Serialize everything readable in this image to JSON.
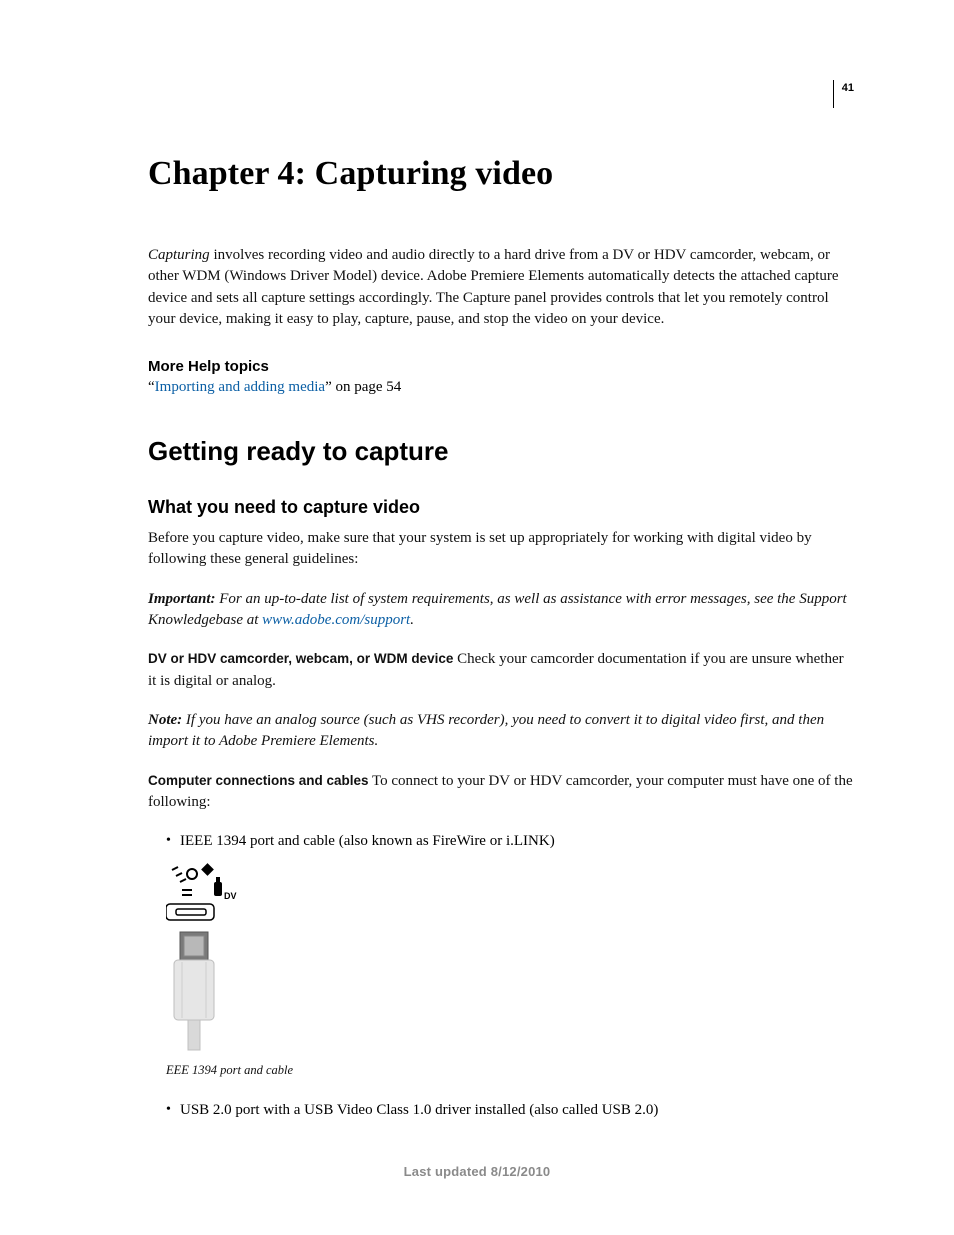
{
  "pageNumber": "41",
  "chapterTitle": "Chapter 4: Capturing video",
  "intro": {
    "leadWord": "Capturing",
    "rest": " involves recording video and audio directly to a hard drive from a DV or HDV camcorder, webcam, or other WDM (Windows Driver Model) device. Adobe Premiere Elements automatically detects the attached capture device and sets all capture settings accordingly. The Capture panel provides controls that let you remotely control your device, making it easy to play, capture, pause, and stop the video on your device."
  },
  "moreHelp": {
    "heading": "More Help topics",
    "quoteOpen": "“",
    "linkText": "Importing and adding media",
    "afterLink": "” on page 54"
  },
  "section1": {
    "title": "Getting ready to capture",
    "subTitle": "What you need to capture video",
    "p1": "Before you capture video, make sure that your system is set up appropriately for working with digital video by following these general guidelines:",
    "important": {
      "label": "Important:",
      "before": " For an up-to-date list of system requirements, as well as assistance with error messages, see the Support Knowledgebase at ",
      "link": "www.adobe.com/support",
      "after": "."
    },
    "dvLine": {
      "label": "DV or HDV camcorder, webcam, or WDM device",
      "text": "   Check your camcorder documentation if you are unsure whether it is digital or analog."
    },
    "note": {
      "label": "Note:",
      "text": " If you have an analog source (such as VHS recorder), you need to convert it to digital video first, and then import it to Adobe Premiere Elements."
    },
    "connLine": {
      "label": "Computer connections and cables",
      "text": "  To connect to your DV or HDV camcorder, your computer must have one of the following:"
    },
    "bullets": [
      "IEEE 1394 port and cable (also known as FireWire or i.LINK)",
      "USB 2.0 port with a USB Video Class 1.0 driver installed (also called USB 2.0)"
    ],
    "figureCaption": "EEE 1394 port and cable",
    "figureLabelDV": "DV"
  },
  "footer": "Last updated 8/12/2010"
}
